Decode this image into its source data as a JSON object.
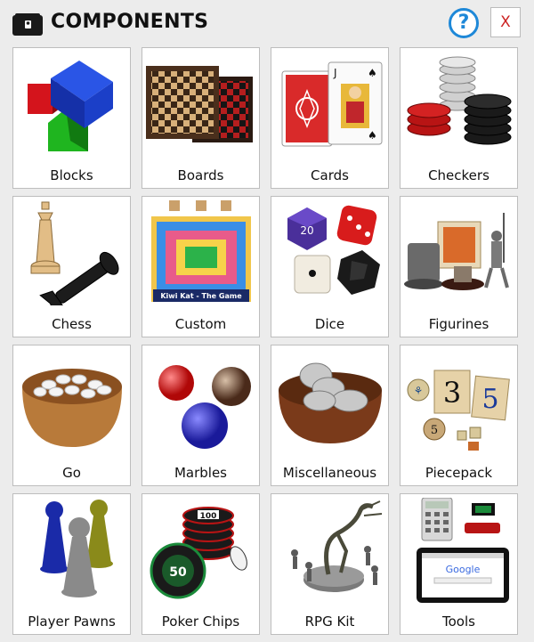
{
  "header": {
    "title": "COMPONENTS",
    "help_label": "?",
    "close_label": "X"
  },
  "colors": {
    "help_blue": "#1e88d8",
    "close_red": "#cc2222",
    "tile_border": "#bdbdbd"
  },
  "tiles": [
    {
      "label": "Blocks",
      "icon": "blocks-icon"
    },
    {
      "label": "Boards",
      "icon": "boards-icon"
    },
    {
      "label": "Cards",
      "icon": "cards-icon"
    },
    {
      "label": "Checkers",
      "icon": "checkers-icon"
    },
    {
      "label": "Chess",
      "icon": "chess-icon"
    },
    {
      "label": "Custom",
      "icon": "custom-board-icon",
      "art_text": "Kiwi Kat - The Game"
    },
    {
      "label": "Dice",
      "icon": "dice-icon",
      "art_text": "20"
    },
    {
      "label": "Figurines",
      "icon": "figurines-icon"
    },
    {
      "label": "Go",
      "icon": "go-bowl-icon"
    },
    {
      "label": "Marbles",
      "icon": "marbles-icon"
    },
    {
      "label": "Miscellaneous",
      "icon": "coins-bowl-icon"
    },
    {
      "label": "Piecepack",
      "icon": "piecepack-icon",
      "art_text": [
        "3",
        "5",
        "5"
      ]
    },
    {
      "label": "Player Pawns",
      "icon": "pawns-icon"
    },
    {
      "label": "Poker Chips",
      "icon": "poker-chips-icon",
      "art_text": [
        "100",
        "50"
      ]
    },
    {
      "label": "RPG Kit",
      "icon": "rpg-kit-icon"
    },
    {
      "label": "Tools",
      "icon": "tools-icon",
      "art_text": "Google"
    }
  ]
}
